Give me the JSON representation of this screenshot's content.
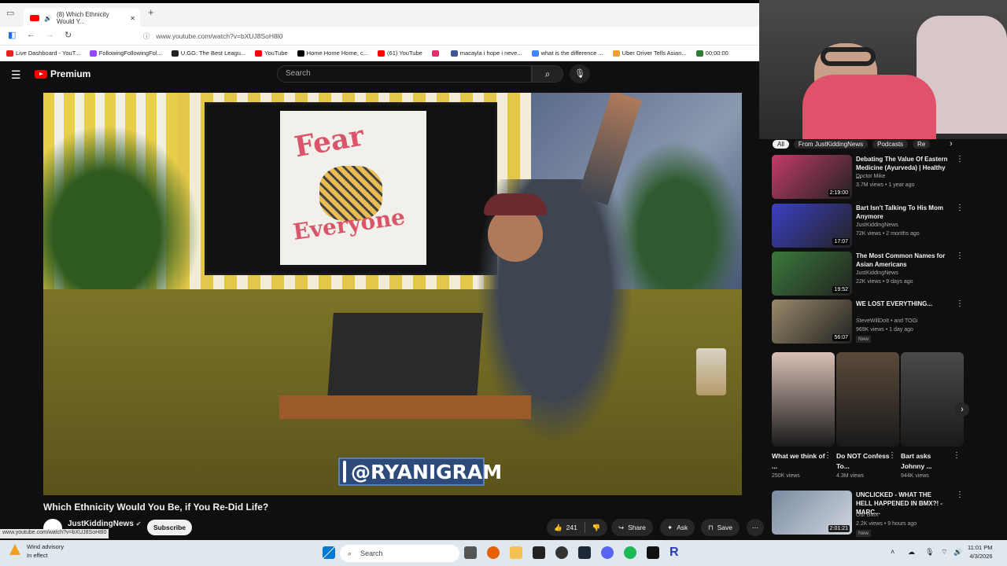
{
  "browser": {
    "tab_title": "(8) Which Ethnicity Would Y...",
    "new_tab": "+",
    "url": "www.youtube.com/watch?v=bXUJ8SoH8l0",
    "bookmarks": [
      {
        "label": "Live Dashboard - YouT...",
        "color": "#e62117"
      },
      {
        "label": "FollowingFollowingFol...",
        "color": "#9146ff"
      },
      {
        "label": "U.GG: The Best Leagu...",
        "color": "#222222"
      },
      {
        "label": "YouTube",
        "color": "#ff0000"
      },
      {
        "label": "Home Home Home, c...",
        "color": "#000000"
      },
      {
        "label": "(61) YouTube",
        "color": "#ff0000"
      },
      {
        "label": "",
        "color": "#e1306c"
      },
      {
        "label": "macayla i hope i neve...",
        "color": "#3b5998"
      },
      {
        "label": "what is the difference ...",
        "color": "#4285f4"
      },
      {
        "label": "Uber Driver Tells Asian...",
        "color": "#f0a030"
      },
      {
        "label": "00:00:00",
        "color": "#2e7d32"
      }
    ]
  },
  "yt_header": {
    "brand": "Premium",
    "search_placeholder": "Search"
  },
  "video": {
    "overlay_handle": "@RYANIGRAM",
    "poster_text_1": "Fear",
    "poster_text_2": "Everyone",
    "title": "Which Ethnicity Would You Be, if You Re-Did Life?",
    "channel": "JustKiddingNews",
    "subscribe_label": "Subscribe",
    "likes": "241",
    "share_label": "Share",
    "ask_label": "Ask",
    "save_label": "Save",
    "status_url": "www.youtube.com/watch?v=bXUJ8SoH8l0"
  },
  "sidebar": {
    "chips": [
      "All",
      "From JustKiddingNews",
      "Podcasts",
      "Re"
    ],
    "recommendations": [
      {
        "title": "Debating The Value Of Eastern Medicine (Ayurveda) | Healthy ...",
        "channel": "Doctor Mike",
        "meta": "3.7M views • 1 year ago",
        "duration": "2:19:00",
        "thumb_color": "#c23a6a",
        "new": ""
      },
      {
        "title": "Bart Isn't Talking To His Mom Anymore",
        "channel": "JustKiddingNews",
        "meta": "72K views • 2 months ago",
        "duration": "17:07",
        "thumb_color": "#3b3fc4",
        "new": ""
      },
      {
        "title": "The Most Common Names for Asian Americans",
        "channel": "JustKiddingNews",
        "meta": "22K views • 9 days ago",
        "duration": "19:52",
        "thumb_color": "#3a7a3a",
        "new": ""
      },
      {
        "title": "WE LOST EVERYTHING...",
        "channel": "SteveWillDoIt • and TOGi",
        "meta": "969K views • 1 day ago",
        "duration": "56:07",
        "thumb_color": "#9a8a6a",
        "new": "New"
      }
    ],
    "shorts": [
      {
        "title": "What we think of ...",
        "views": "250K views",
        "color": "#d9c0b5"
      },
      {
        "title": "Do NOT Confess To...",
        "views": "4.3M views",
        "color": "#5a4a3a"
      },
      {
        "title": "Bart asks Johnny ...",
        "views": "944K views",
        "color": "#4a4a4a"
      }
    ],
    "last_rec": {
      "title": "UNCLICKED - WHAT THE HELL HAPPENED IN BMX?! - MARC...",
      "channel": "Our BMX",
      "meta": "2.2K views • 9 hours ago",
      "duration": "2:01:21",
      "new": "New"
    }
  },
  "taskbar": {
    "weather_title": "Wind advisory",
    "weather_sub": "In effect",
    "search_label": "Search",
    "time": "11:01 PM",
    "date": "4/3/2026"
  }
}
